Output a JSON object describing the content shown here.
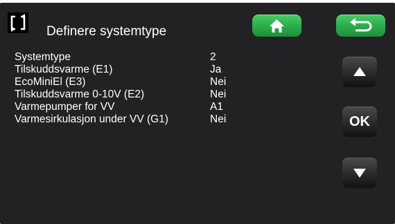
{
  "header": {
    "title": "Definere systemtype",
    "screen_icon": "screen-toggle-icon",
    "home_icon": "home-icon",
    "back_icon": "back-arrow-icon"
  },
  "settings": [
    {
      "label": "Systemtype",
      "value": "2"
    },
    {
      "label": "Tilskuddsvarme (E1)",
      "value": "Ja"
    },
    {
      "label": "EcoMiniEl (E3)",
      "value": "Nei"
    },
    {
      "label": "Tilskuddsvarme 0-10V (E2)",
      "value": "Nei"
    },
    {
      "label": "Varmepumper for VV",
      "value": "A1"
    },
    {
      "label": "Varmesirkulasjon under VV (G1)",
      "value": "Nei"
    }
  ],
  "controls": {
    "up_icon": "up-triangle-icon",
    "ok_label": "OK",
    "down_icon": "down-triangle-icon"
  },
  "colors": {
    "background": "#222224",
    "nav_button": "#2fb04e",
    "side_button": "#2a2a2a",
    "text": "#ffffff"
  }
}
